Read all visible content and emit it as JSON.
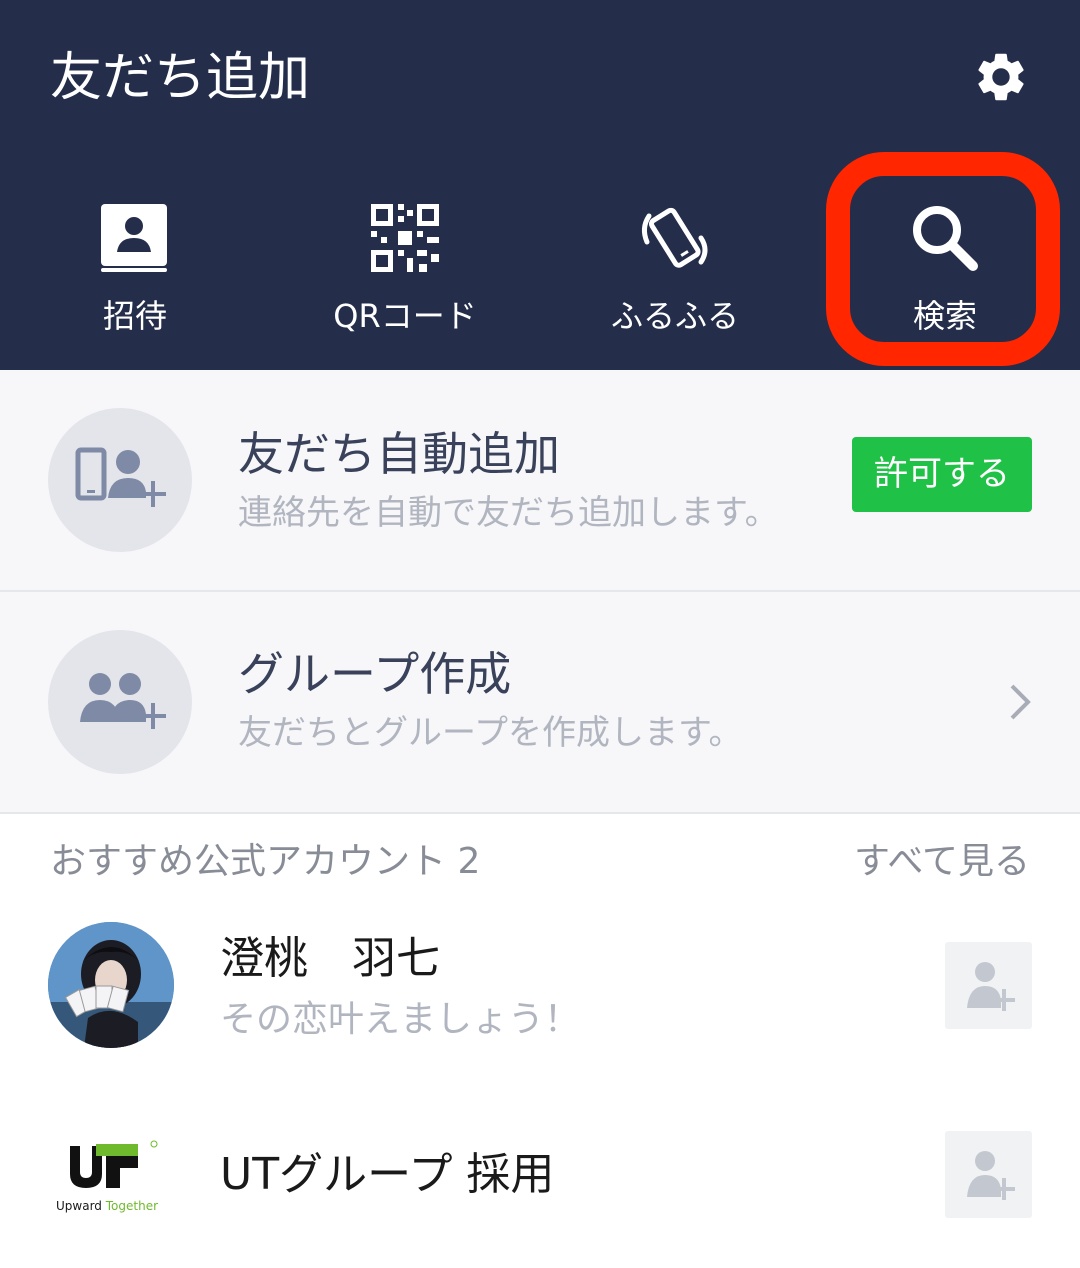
{
  "header": {
    "title": "友だち追加",
    "settings_icon": "gear-icon",
    "actions": [
      {
        "label": "招待",
        "icon": "contact-book-icon"
      },
      {
        "label": "QRコード",
        "icon": "qr-code-icon"
      },
      {
        "label": "ふるふる",
        "icon": "shake-phone-icon"
      },
      {
        "label": "検索",
        "icon": "search-icon"
      }
    ]
  },
  "auto_add": {
    "title": "友だち自動追加",
    "subtitle": "連絡先を自動で友だち追加します。",
    "button": "許可する"
  },
  "group_create": {
    "title": "グループ作成",
    "subtitle": "友だちとグループを作成します。"
  },
  "recommended": {
    "heading": "おすすめ公式アカウント 2",
    "see_all": "すべて見る",
    "accounts": [
      {
        "name": "澄桃　羽七",
        "subtitle": "その恋叶えましょう！"
      },
      {
        "name": "UTグループ 採用",
        "subtitle": ""
      }
    ],
    "ut_logo": {
      "mark": "UT",
      "tagline_a": "Upward",
      "tagline_b": "Together"
    }
  },
  "colors": {
    "header_bg": "#242e4a",
    "highlight": "#ff2600",
    "allow_button": "#1fc246"
  }
}
